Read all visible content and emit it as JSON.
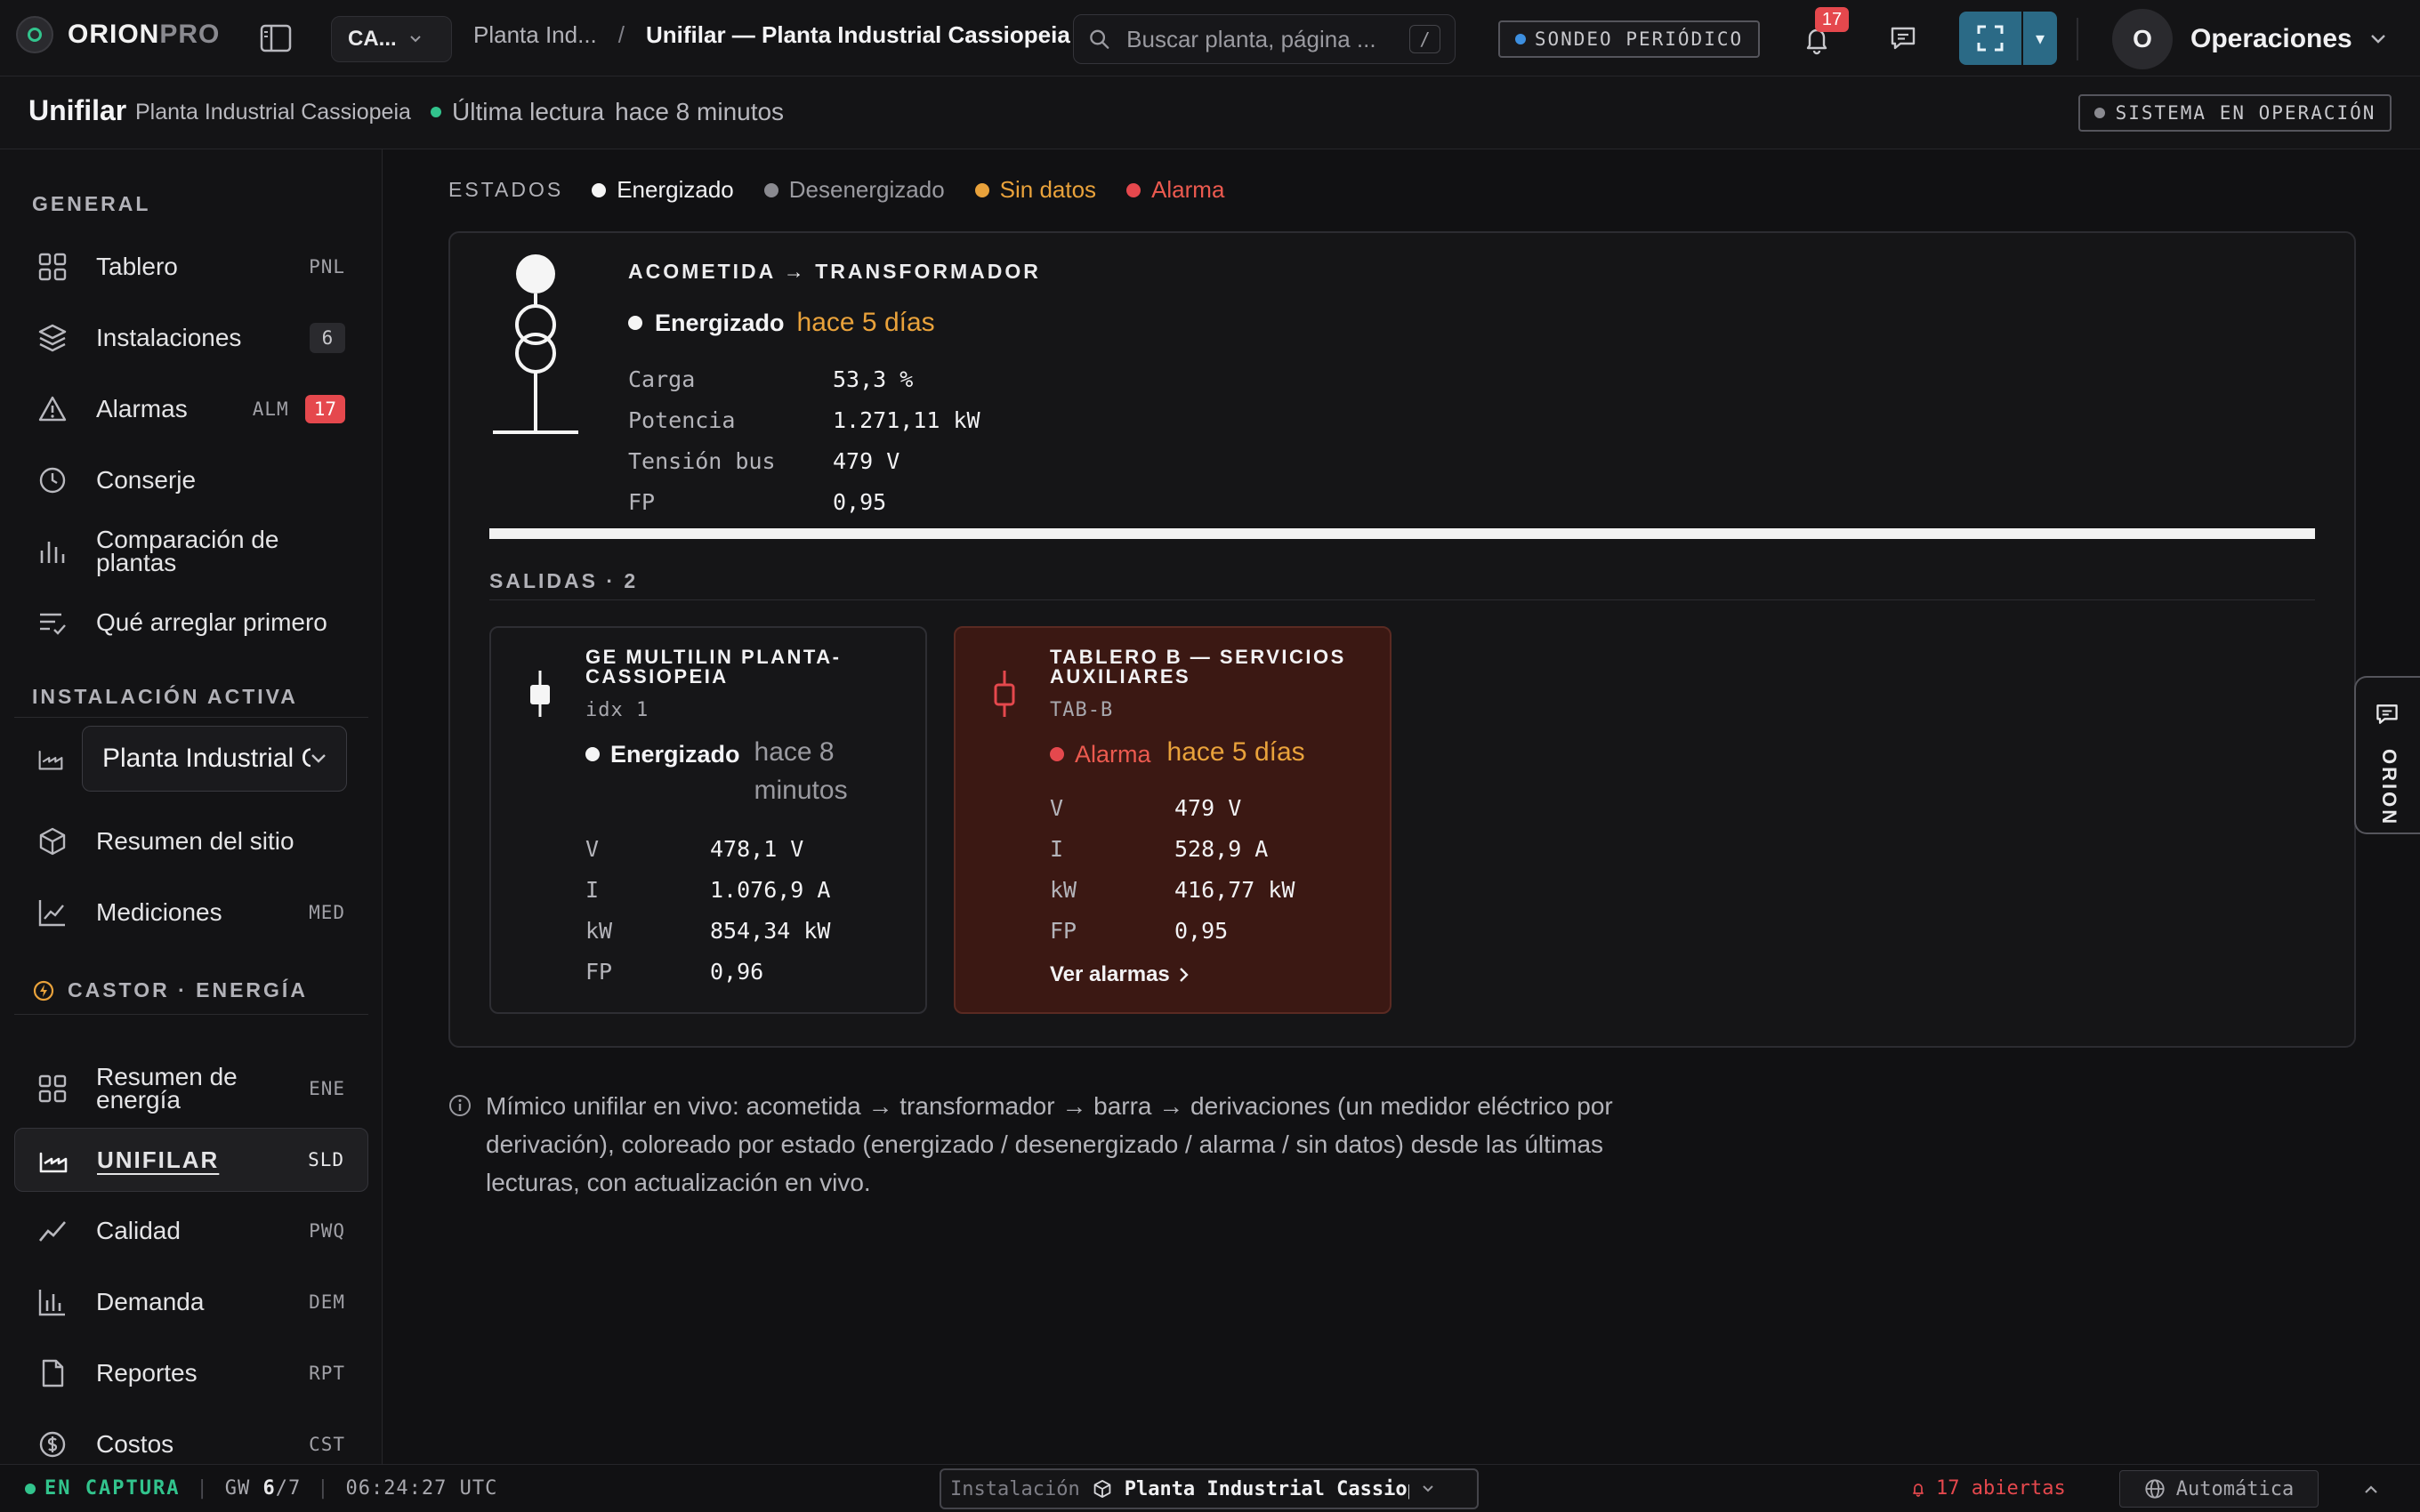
{
  "brand": {
    "name_bold": "ORION",
    "name_light": "PRO"
  },
  "header": {
    "org_short": "CA...",
    "breadcrumb_parent": "Planta Ind...",
    "breadcrumb_sep": "/",
    "breadcrumb_current": "Unifilar — Planta Industrial Cassiopeia",
    "search_placeholder": "Buscar planta, página ...",
    "search_shortcut": "/",
    "poll_label": "SONDEO PERIÓDICO",
    "notifications_count": "17",
    "user_initial": "O",
    "user_name": "Operaciones"
  },
  "subheader": {
    "title": "Unifilar",
    "site": "Planta Industrial Cassiopeia",
    "reading_label": "Última lectura",
    "reading_ago": "hace 8 minutos",
    "system_status": "SISTEMA EN OPERACIÓN"
  },
  "sidebar": {
    "general_label": "GENERAL",
    "items": [
      {
        "label": "Tablero",
        "code": "PNL"
      },
      {
        "label": "Instalaciones",
        "count": "6"
      },
      {
        "label": "Alarmas",
        "code": "ALM",
        "count": "17"
      },
      {
        "label": "Conserje"
      },
      {
        "label": "Comparación de plantas"
      },
      {
        "label": "Qué arreglar primero"
      }
    ],
    "active_install_label": "INSTALACIÓN ACTIVA",
    "active_install_value": "Planta Industrial Cassiopeia",
    "site_items": [
      {
        "label": "Resumen del sitio"
      },
      {
        "label": "Mediciones",
        "code": "MED"
      }
    ],
    "energy_label": "CASTOR · ENERGÍA",
    "energy_items": [
      {
        "label": "Resumen de energía",
        "code": "ENE"
      },
      {
        "label": "UNIFILAR",
        "code": "SLD"
      },
      {
        "label": "Calidad",
        "code": "PWQ"
      },
      {
        "label": "Demanda",
        "code": "DEM"
      },
      {
        "label": "Reportes",
        "code": "RPT"
      },
      {
        "label": "Costos",
        "code": "CST"
      }
    ]
  },
  "legend": {
    "label": "ESTADOS",
    "items": [
      {
        "label": "Energizado",
        "color": "#f5f5f5"
      },
      {
        "label": "Desenergizado",
        "color": "#8a8a90"
      },
      {
        "label": "Sin datos",
        "color": "#e9a23b"
      },
      {
        "label": "Alarma",
        "color": "#e5484d"
      }
    ]
  },
  "feed": {
    "title": "ACOMETIDA → TRANSFORMADOR",
    "status": "Energizado",
    "ago": "hace 5 días",
    "metrics": [
      {
        "k": "Carga",
        "v": "53,3 %"
      },
      {
        "k": "Potencia",
        "v": "1.271,11 kW"
      },
      {
        "k": "Tensión bus",
        "v": "479 V"
      },
      {
        "k": "FP",
        "v": "0,95"
      }
    ]
  },
  "outputs": {
    "label": "SALIDAS · 2",
    "cards": [
      {
        "title": "GE MULTILIN PLANTA-CASSIOPEIA",
        "id": "idx 1",
        "status": "Energizado",
        "ago": "hace 8 minutos",
        "metrics": [
          {
            "k": "V",
            "v": "478,1 V"
          },
          {
            "k": "I",
            "v": "1.076,9 A"
          },
          {
            "k": "kW",
            "v": "854,34 kW"
          },
          {
            "k": "FP",
            "v": "0,96"
          }
        ]
      },
      {
        "title": "TABLERO B — SERVICIOS AUXILIARES",
        "id": "TAB-B",
        "status": "Alarma",
        "ago": "hace 5 días",
        "metrics": [
          {
            "k": "V",
            "v": "479 V"
          },
          {
            "k": "I",
            "v": "528,9 A"
          },
          {
            "k": "kW",
            "v": "416,77 kW"
          },
          {
            "k": "FP",
            "v": "0,95"
          }
        ],
        "link": "Ver alarmas"
      }
    ]
  },
  "side_tab": "ORION",
  "info_note": "Mímico unifilar en vivo: acometida → transformador → barra → derivaciones (un medidor eléctrico por derivación), coloreado por estado (energizado / desenergizado / alarma / sin datos) desde las últimas lecturas, con actualización en vivo.",
  "statusbar": {
    "capture": "EN CAPTURA",
    "gw_label": "GW",
    "gw_on": "6",
    "gw_total": "/7",
    "time": "06:24:27 UTC",
    "install_key": "Instalación",
    "install_value": "Planta Industrial Cassiopeia",
    "alarms": "17 abiertas",
    "mode": "Automática"
  },
  "colors": {
    "energized": "#f5f5f5",
    "deenergized": "#8a8a90",
    "nodata": "#e9a23b",
    "alarm": "#e5484d",
    "accent": "#2b6a86",
    "ok": "#32c48d"
  }
}
